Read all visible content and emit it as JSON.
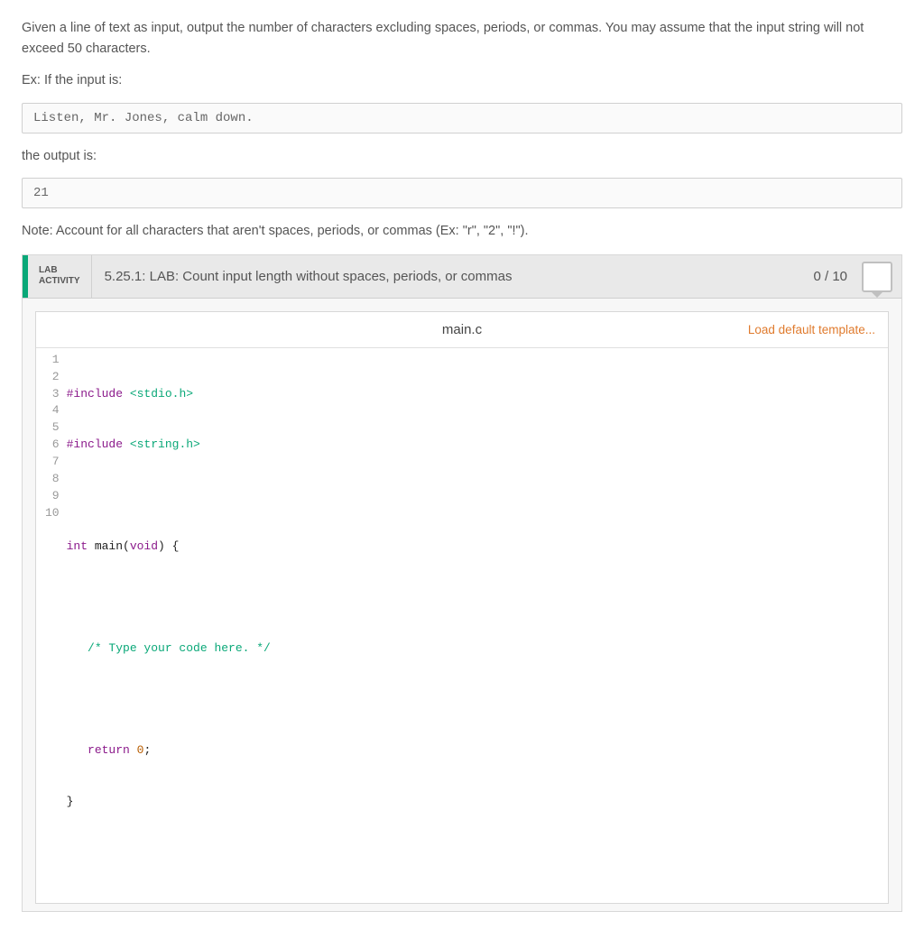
{
  "problem": {
    "description": "Given a line of text as input, output the number of characters excluding spaces, periods, or commas. You may assume that the input string will not exceed 50 characters.",
    "ex_label": "Ex: If the input is:",
    "input_example": "Listen, Mr. Jones, calm down.",
    "output_label": "the output is:",
    "output_example": "21",
    "note": "Note: Account for all characters that aren't spaces, periods, or commas (Ex: \"r\", \"2\", \"!\")."
  },
  "lab": {
    "activity_line1": "LAB",
    "activity_line2": "ACTIVITY",
    "title": "5.25.1: LAB: Count input length without spaces, periods, or commas",
    "score": "0 / 10",
    "filename": "main.c",
    "load_template": "Load default template..."
  },
  "code": {
    "lines": [
      {
        "n": "1"
      },
      {
        "n": "2"
      },
      {
        "n": "3"
      },
      {
        "n": "4"
      },
      {
        "n": "5"
      },
      {
        "n": "6"
      },
      {
        "n": "7"
      },
      {
        "n": "8"
      },
      {
        "n": "9"
      },
      {
        "n": "10"
      }
    ],
    "l1_kw": "#include",
    "l1_str": " <stdio.h>",
    "l2_kw": "#include",
    "l2_str": " <string.h>",
    "l3": "",
    "l4_kw": "int",
    "l4_rest": " main(",
    "l4_kw2": "void",
    "l4_rest2": ") {",
    "l5": "",
    "l6_pad": "   ",
    "l6_cm": "/* Type your code here. */",
    "l7": "",
    "l8_pad": "   ",
    "l8_kw": "return",
    "l8_sp": " ",
    "l8_num": "0",
    "l8_semi": ";",
    "l9": "}",
    "l10": ""
  }
}
